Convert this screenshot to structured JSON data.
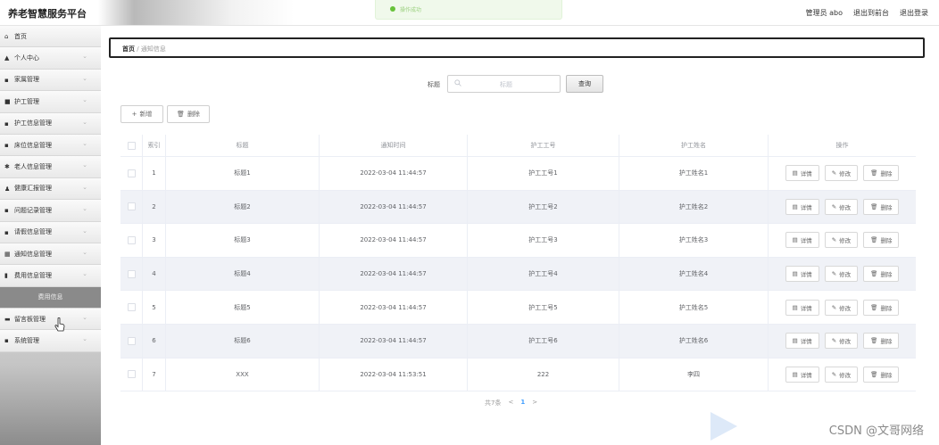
{
  "header": {
    "app_title": "养老智慧服务平台",
    "toast": "操作成功",
    "user_label": "管理员 abo",
    "back_front": "退出到前台",
    "logout": "退出登录"
  },
  "sidebar": {
    "items": [
      {
        "icon": "home-icon",
        "glyph": "⌂",
        "label": "首页",
        "chevron": false
      },
      {
        "icon": "user-icon",
        "glyph": "▲",
        "label": "个人中心",
        "chevron": true
      },
      {
        "icon": "grid-icon",
        "glyph": "▪",
        "label": "家属管理",
        "chevron": true
      },
      {
        "icon": "square-icon",
        "glyph": "■",
        "label": "护工管理",
        "chevron": true
      },
      {
        "icon": "grid-icon",
        "glyph": "▪",
        "label": "护工信息管理",
        "chevron": true
      },
      {
        "icon": "grid-icon",
        "glyph": "▪",
        "label": "床位信息管理",
        "chevron": true
      },
      {
        "icon": "star-icon",
        "glyph": "✱",
        "label": "老人信息管理",
        "chevron": true
      },
      {
        "icon": "person-icon",
        "glyph": "♟",
        "label": "健康汇报管理",
        "chevron": true
      },
      {
        "icon": "grid-icon",
        "glyph": "▪",
        "label": "问题记录管理",
        "chevron": true
      },
      {
        "icon": "grid-icon",
        "glyph": "▪",
        "label": "请假信息管理",
        "chevron": true
      },
      {
        "icon": "table-icon",
        "glyph": "▦",
        "label": "通知信息管理",
        "chevron": true
      },
      {
        "icon": "bar-chart-icon",
        "glyph": "▮",
        "label": "费用信息管理",
        "chevron": true
      },
      {
        "icon": "",
        "glyph": "",
        "label": "费用信息",
        "chevron": false,
        "sub": true
      },
      {
        "icon": "folder-icon",
        "glyph": "▬",
        "label": "留言板管理",
        "chevron": true
      },
      {
        "icon": "grid-icon",
        "glyph": "▪",
        "label": "系统管理",
        "chevron": true
      }
    ]
  },
  "breadcrumb": {
    "home": "首页",
    "separator": "/",
    "current": "通知信息"
  },
  "search": {
    "label": "标题",
    "placeholder": "标题",
    "button": "查询"
  },
  "toolbar": {
    "add": "新增",
    "delete": "删除"
  },
  "table": {
    "columns": [
      "",
      "索引",
      "标题",
      "通知时间",
      "护工工号",
      "护工姓名",
      "操作"
    ],
    "rows": [
      {
        "index": "1",
        "title": "标题1",
        "time": "2022-03-04 11:44:57",
        "worker_id": "护工工号1",
        "worker_name": "护工姓名1"
      },
      {
        "index": "2",
        "title": "标题2",
        "time": "2022-03-04 11:44:57",
        "worker_id": "护工工号2",
        "worker_name": "护工姓名2"
      },
      {
        "index": "3",
        "title": "标题3",
        "time": "2022-03-04 11:44:57",
        "worker_id": "护工工号3",
        "worker_name": "护工姓名3"
      },
      {
        "index": "4",
        "title": "标题4",
        "time": "2022-03-04 11:44:57",
        "worker_id": "护工工号4",
        "worker_name": "护工姓名4"
      },
      {
        "index": "5",
        "title": "标题5",
        "time": "2022-03-04 11:44:57",
        "worker_id": "护工工号5",
        "worker_name": "护工姓名5"
      },
      {
        "index": "6",
        "title": "标题6",
        "time": "2022-03-04 11:44:57",
        "worker_id": "护工工号6",
        "worker_name": "护工姓名6"
      },
      {
        "index": "7",
        "title": "XXX",
        "time": "2022-03-04 11:53:51",
        "worker_id": "222",
        "worker_name": "李四"
      }
    ],
    "actions": {
      "detail": "详情",
      "edit": "修改",
      "delete": "删除"
    }
  },
  "pagination": {
    "total": "共7条",
    "prev": "<",
    "current": "1",
    "next": ">"
  },
  "watermark": "CSDN @文哥网络",
  "colors": {
    "toast_bg": "#f0f9eb",
    "success": "#67c23a",
    "page_active": "#409eff",
    "stripe": "#f0f2f7"
  }
}
